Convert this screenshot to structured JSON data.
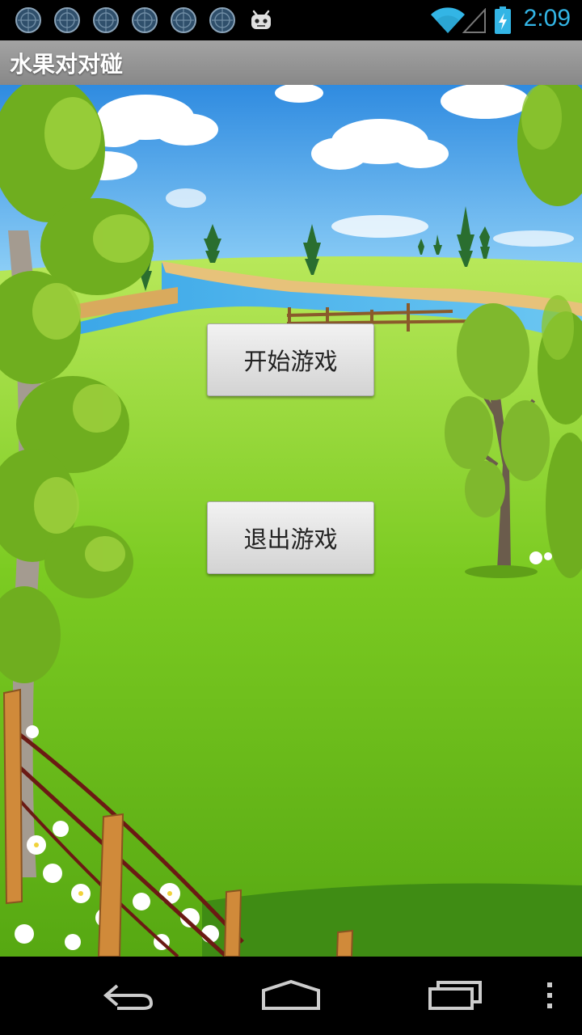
{
  "status_bar": {
    "time": "2:09",
    "notifications": [
      "globe-icon",
      "globe-icon",
      "globe-icon",
      "globe-icon",
      "globe-icon",
      "globe-icon",
      "android-icon"
    ],
    "wifi_icon": "wifi-icon",
    "signal_icon": "signal-icon",
    "battery_icon": "battery-charging-icon"
  },
  "action_bar": {
    "title": "水果对对碰"
  },
  "menu": {
    "start_label": "开始游戏",
    "exit_label": "退出游戏"
  },
  "nav_bar": {
    "back": "back-icon",
    "home": "home-icon",
    "recents": "recents-icon",
    "overflow": "overflow-menu-icon"
  },
  "colors": {
    "accent": "#33b5e5",
    "grass": "#6cc21c",
    "sky": "#43a6ec"
  }
}
